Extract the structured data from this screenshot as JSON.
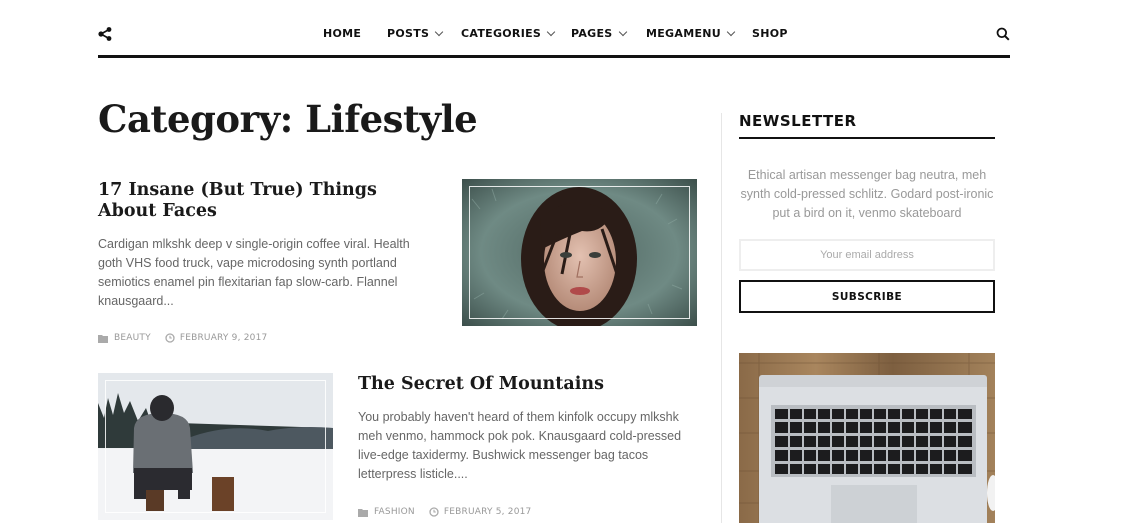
{
  "header": {
    "share_icon": "share-icon",
    "search_icon": "search-icon",
    "nav": [
      {
        "label": "HOME",
        "dropdown": false
      },
      {
        "label": "POSTS",
        "dropdown": true
      },
      {
        "label": "CATEGORIES",
        "dropdown": true
      },
      {
        "label": "PAGES",
        "dropdown": true
      },
      {
        "label": "MEGAMENU",
        "dropdown": true
      },
      {
        "label": "SHOP",
        "dropdown": false
      }
    ]
  },
  "main": {
    "page_title": "Category: Lifestyle",
    "posts": [
      {
        "title": "17 Insane (But True) Things About Faces",
        "excerpt": "Cardigan mlkshk deep v single-origin coffee viral. Health goth VHS food truck, vape microdosing synth portland semiotics enamel pin flexitarian fap slow-carb. Flannel knausgaard...",
        "category": "BEAUTY",
        "date": "FEBRUARY 9, 2017"
      },
      {
        "title": "The Secret Of Mountains",
        "excerpt": "You probably haven't heard of them kinfolk occupy mlkshk meh venmo, hammock pok pok. Knausgaard cold-pressed live-edge taxidermy. Bushwick messenger bag tacos letterpress listicle....",
        "category": "FASHION",
        "date": "FEBRUARY 5, 2017"
      }
    ]
  },
  "sidebar": {
    "newsletter": {
      "title": "NEWSLETTER",
      "text": "Ethical artisan messenger bag neutra, meh synth cold-pressed schlitz. Godard post-ironic put a bird on it, venmo skateboard",
      "email_placeholder": "Your email address",
      "subscribe_label": "SUBSCRIBE"
    }
  },
  "colors": {
    "text_dark": "#111111",
    "text_muted": "#666666",
    "meta": "#999999",
    "rule": "#111111"
  }
}
